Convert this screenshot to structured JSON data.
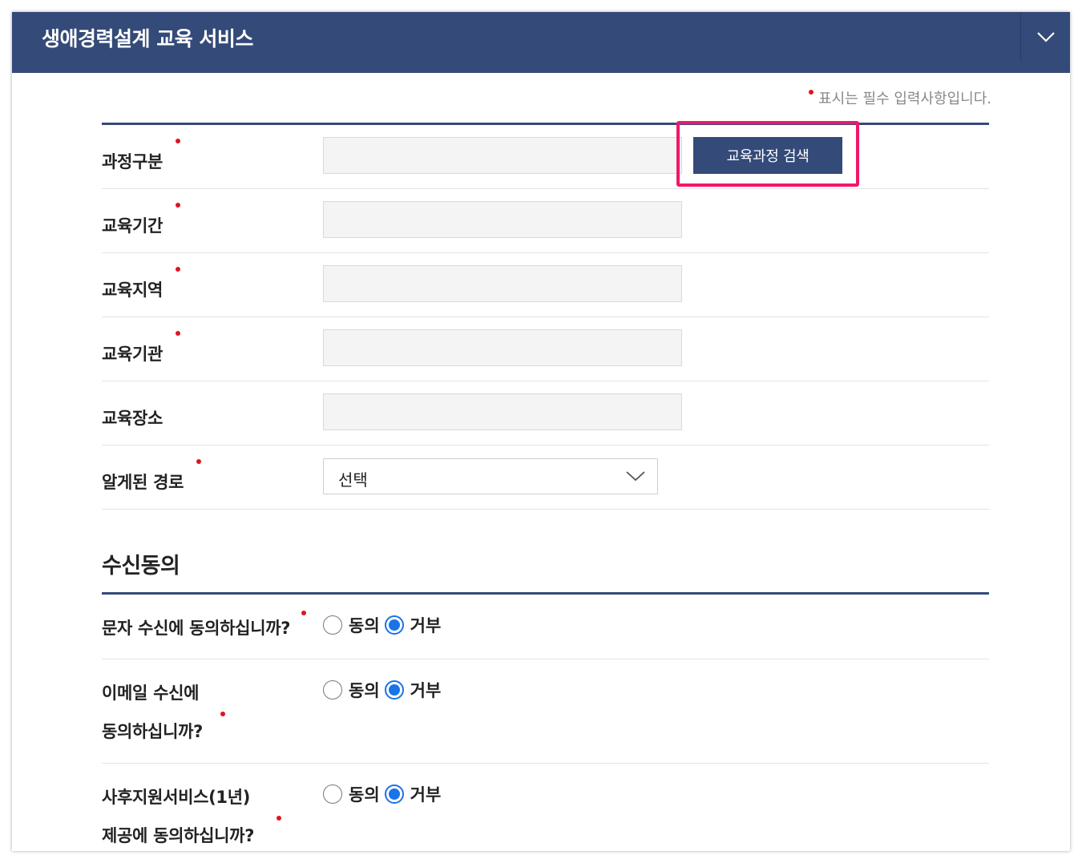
{
  "header": {
    "title": "생애경력설계 교육 서비스"
  },
  "required_note": "표시는 필수 입력사항입니다.",
  "colors": {
    "header_bg": "#344a78",
    "required_dot": "#e0141e",
    "highlight": "#f0186a",
    "radio_checked": "#1a73e8"
  },
  "fields": {
    "course_type": {
      "label": "과정구분",
      "value": "",
      "button": "교육과정 검색"
    },
    "period": {
      "label": "교육기간",
      "value": ""
    },
    "region": {
      "label": "교육지역",
      "value": ""
    },
    "institution": {
      "label": "교육기관",
      "value": ""
    },
    "place": {
      "label": "교육장소",
      "value": ""
    },
    "referral": {
      "label": "알게된 경로",
      "selected": "선택"
    }
  },
  "consent": {
    "title": "수신동의",
    "sms": {
      "label_line1": "문자 수신에 동의하십니까?",
      "agree": "동의",
      "decline": "거부",
      "selected": "거부"
    },
    "email": {
      "label_line1": "이메일 수신에",
      "label_line2": "동의하십니까?",
      "agree": "동의",
      "decline": "거부",
      "selected": "거부"
    },
    "followup": {
      "label_line1": "사후지원서비스(1년)",
      "label_line2": "제공에 동의하십니까?",
      "agree": "동의",
      "decline": "거부",
      "selected": "거부"
    }
  }
}
